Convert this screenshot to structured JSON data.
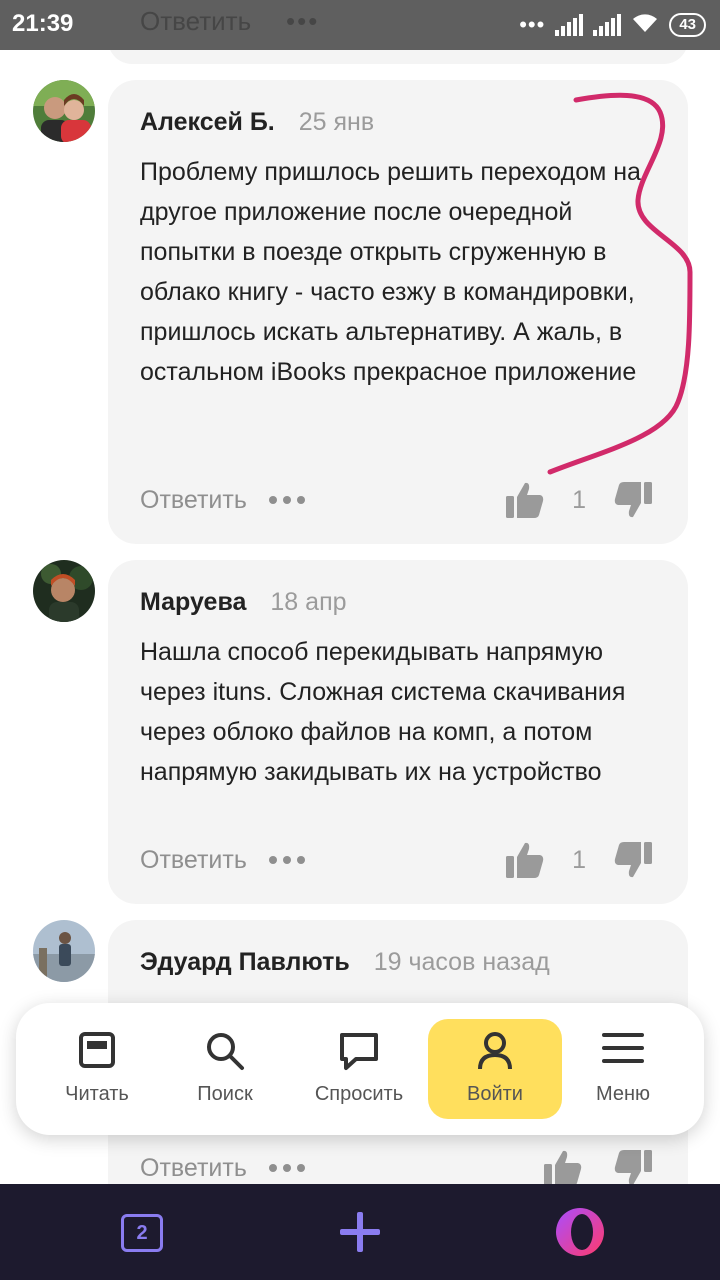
{
  "status_bar": {
    "time": "21:39",
    "battery": "43",
    "ghost_reply": "Ответить"
  },
  "comments": [
    {
      "author": "Алексей Б.",
      "date": "25 янв",
      "text": "Проблему пришлось решить переходом на другое приложение после очередной попытки в поезде открыть сгруженную в облако книгу - часто езжу в командировки, пришлось искать альтернативу. А жаль, в остальном iBooks прекрасное приложение",
      "reply": "Ответить",
      "likes": "1"
    },
    {
      "author": "Маруева",
      "date": "18 апр",
      "text": "Нашла способ перекидывать напрямую через ituns. Сложная система скачивания через облоко файлов на комп, а потом напрямую закидывать их на устройство",
      "reply": "Ответить",
      "likes": "1"
    },
    {
      "author": "Эдуард Павлють",
      "date": "19 часов назад",
      "reply": "Ответить"
    }
  ],
  "nav": {
    "items": [
      {
        "label": "Читать",
        "icon": "read-icon"
      },
      {
        "label": "Поиск",
        "icon": "search-icon"
      },
      {
        "label": "Спросить",
        "icon": "chat-icon"
      },
      {
        "label": "Войти",
        "icon": "user-icon",
        "active": true
      },
      {
        "label": "Меню",
        "icon": "menu-icon"
      }
    ],
    "active_color": "#ffdf5d"
  },
  "browser_bar": {
    "tab_count": "2",
    "accent": "#8a7cf0"
  },
  "annotation_color": "#d12a6a"
}
